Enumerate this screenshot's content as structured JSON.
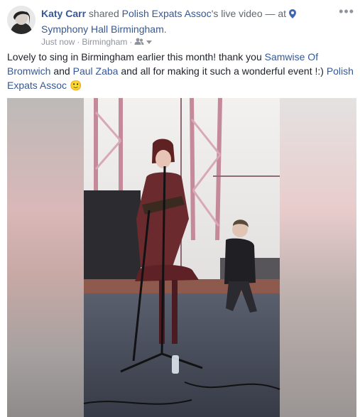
{
  "post": {
    "author": "Katy Carr",
    "shared_word": "shared",
    "page_name": "Polish Expats Assoc",
    "possessive": "'s live video — at",
    "location": "Symphony Hall Birmingham",
    "location_suffix": ".",
    "time": "Just now",
    "separator": "·",
    "place": "Birmingham",
    "separator2": "·",
    "message": {
      "intro": "Lovely to sing in Birmingham earlier this month! thank you",
      "mention1": "Samwise Of Bromwich",
      "and": "and",
      "mention2": "Paul Zaba",
      "outro": "and all for making it such a wonderful event !:)",
      "mention3": "Polish Expats Assoc",
      "emoji": "🙂"
    }
  },
  "icons": {
    "menu": "more-options-icon",
    "location": "location-pin-icon",
    "privacy": "friends-icon",
    "dropdown": "chevron-down-icon"
  },
  "colors": {
    "link": "#365899",
    "meta": "#90949c",
    "text": "#1d2129"
  }
}
